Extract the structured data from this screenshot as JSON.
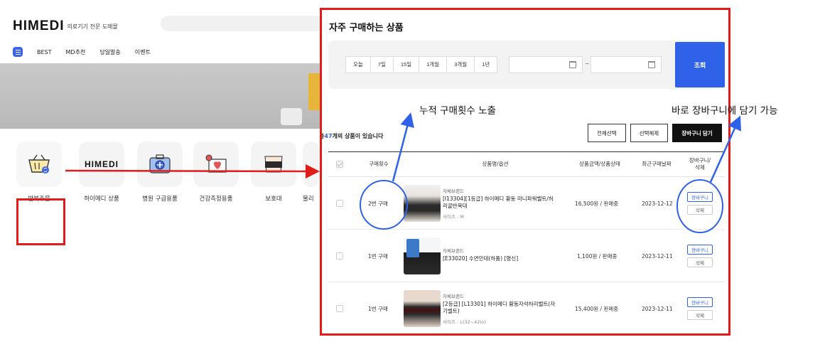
{
  "site": {
    "logo_text": "HIMEDI",
    "logo_sub": "의료기기 전문 도매몰",
    "nav": [
      "BEST",
      "MD추천",
      "당일발송",
      "이벤트"
    ],
    "categories": [
      "반복주문",
      "하이메디 상품",
      "병원 구급용품",
      "건강측정용품",
      "보호대",
      "물리"
    ]
  },
  "panel": {
    "title": "자주 구매하는 상품",
    "period_buttons": [
      "오늘",
      "7일",
      "15일",
      "1개월",
      "3개월",
      "1년"
    ],
    "date_separator": "~",
    "search_button": "조회",
    "summary_prefix": "총",
    "summary_count": "47",
    "summary_suffix": "개의 상품이 있습니다",
    "actions": [
      "전체선택",
      "선택해제",
      "장바구니 담기"
    ],
    "headers": [
      "구매횟수",
      "상품명/옵션",
      "상품금액/상품상태",
      "최근구매날짜",
      "장바구니/\n삭제"
    ],
    "rows": [
      {
        "count": "2번 구매",
        "brand": "자체브랜드",
        "name": "[I13304][1등급] 하이메디 황동 미니파워벨트/허리골반복대",
        "option": "사이즈 : M",
        "price": "16,500원 / 판매중",
        "date": "2023-12-12",
        "cart": "장바구니",
        "delete": "삭제"
      },
      {
        "count": "1번 구매",
        "brand": "자체브랜드",
        "name": "[E33020] 수면안대(하품) [명신]",
        "option": "",
        "price": "1,100원 / 판매중",
        "date": "2023-12-11",
        "cart": "장바구니",
        "delete": "삭제"
      },
      {
        "count": "1번 구매",
        "brand": "자체브랜드",
        "name": "[2등급] [L13301] 하이메디 황동자석허리벨트(자기벨트)",
        "option": "사이즈 : L(32~42in)",
        "price": "15,400원 / 판매중",
        "date": "2023-12-11",
        "cart": "장바구니",
        "delete": "삭제"
      }
    ]
  },
  "annotations": {
    "count_note": "누적 구매횟수 노출",
    "cart_note": "바로 장바구니에 담기 가능"
  },
  "colors": {
    "accent": "#2f62e8",
    "highlight": "#e21b1b"
  }
}
